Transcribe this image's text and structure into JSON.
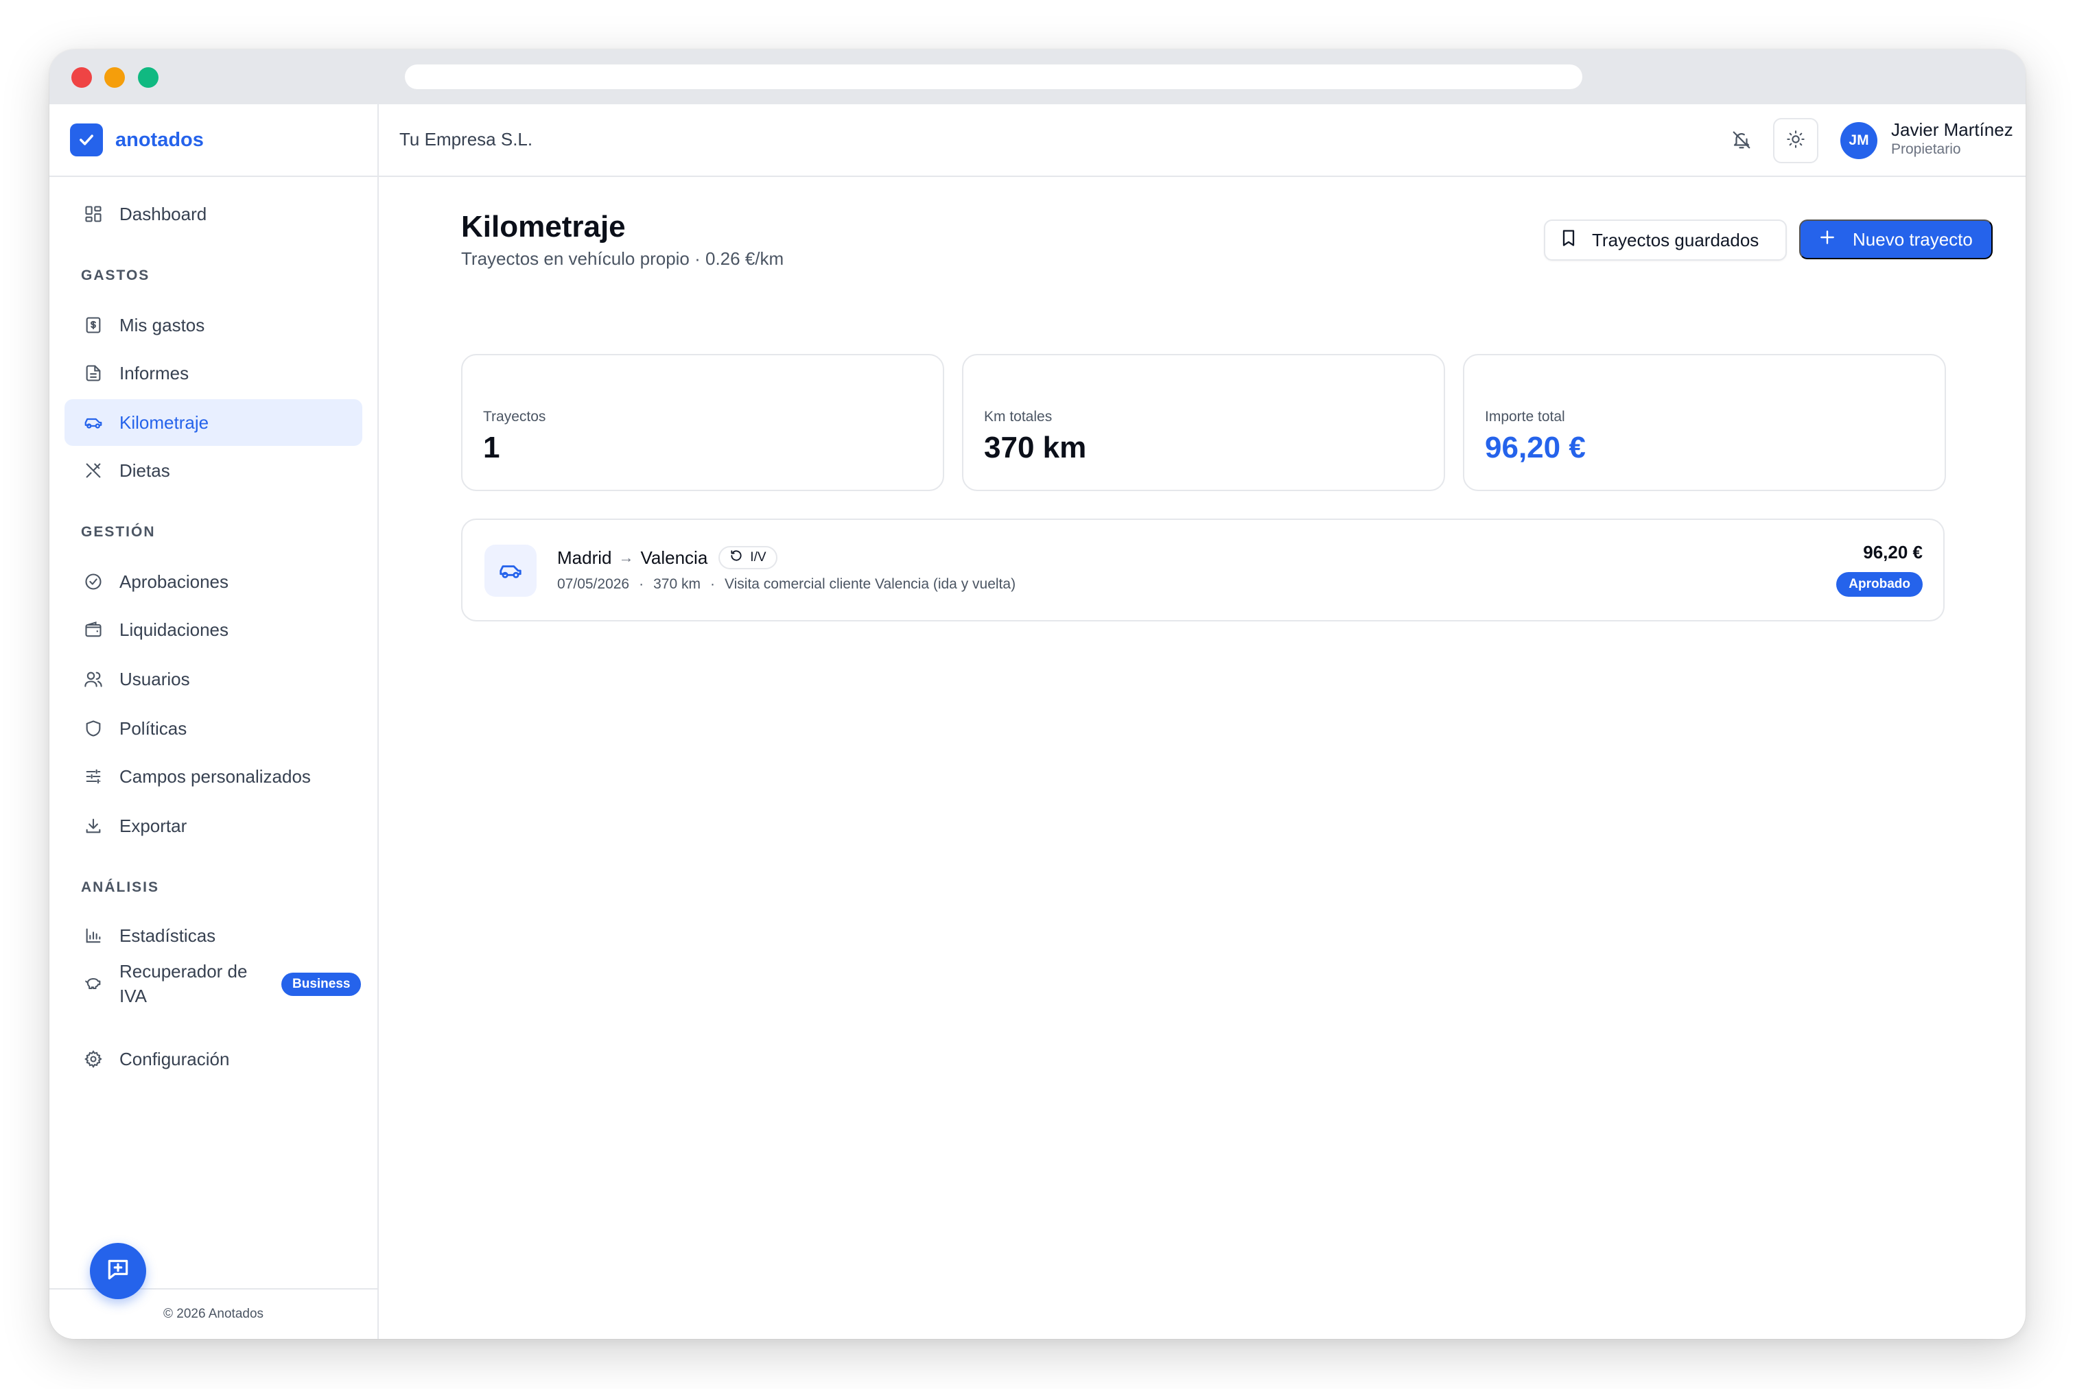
{
  "brand": {
    "name": "anotados"
  },
  "sidebar": {
    "items": [
      {
        "key": "dashboard",
        "label": "Dashboard"
      },
      {
        "key": "mis-gastos",
        "label": "Mis gastos"
      },
      {
        "key": "informes",
        "label": "Informes"
      },
      {
        "key": "kilometraje",
        "label": "Kilometraje",
        "active": true
      },
      {
        "key": "dietas",
        "label": "Dietas"
      },
      {
        "key": "aprobaciones",
        "label": "Aprobaciones"
      },
      {
        "key": "liquidaciones",
        "label": "Liquidaciones"
      },
      {
        "key": "usuarios",
        "label": "Usuarios"
      },
      {
        "key": "politicas",
        "label": "Políticas"
      },
      {
        "key": "campos",
        "label": "Campos personalizados"
      },
      {
        "key": "exportar",
        "label": "Exportar"
      },
      {
        "key": "estadisticas",
        "label": "Estadísticas"
      },
      {
        "key": "recuperador-iva",
        "label": "Recuperador de IVA",
        "badge": "Business"
      },
      {
        "key": "configuracion",
        "label": "Configuración"
      }
    ],
    "sections": {
      "gastos": "GASTOS",
      "gestion": "GESTIÓN",
      "analisis": "ANÁLISIS"
    },
    "footer": "© 2026 Anotados"
  },
  "header": {
    "company": "Tu Empresa S.L.",
    "user": {
      "initials": "JM",
      "name": "Javier Martínez",
      "role": "Propietario"
    }
  },
  "page": {
    "title": "Kilometraje",
    "subtitle": "Trayectos en vehículo propio · 0.26 €/km",
    "saved_button": "Trayectos guardados",
    "new_button": "Nuevo trayecto"
  },
  "stats": [
    {
      "label": "Trayectos",
      "value": "1"
    },
    {
      "label": "Km totales",
      "value": "370 km"
    },
    {
      "label": "Importe total",
      "value": "96,20 €"
    }
  ],
  "trips": [
    {
      "origin": "Madrid",
      "destination": "Valencia",
      "round_trip": "I/V",
      "date": "07/05/2026",
      "distance": "370 km",
      "description": "Visita comercial cliente Valencia (ida y vuelta)",
      "amount": "96,20 €",
      "status": "Aprobado"
    }
  ],
  "colors": {
    "accent": "#2563eb",
    "active_bg": "#e8efff",
    "border": "#e5e7eb"
  }
}
